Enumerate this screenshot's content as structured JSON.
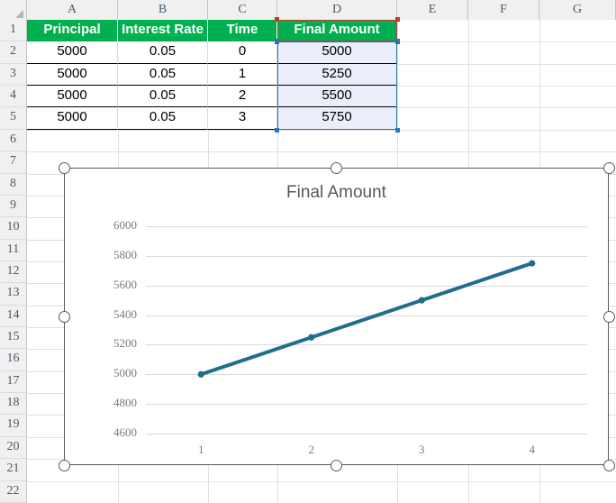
{
  "spreadsheet": {
    "column_headers": [
      "A",
      "B",
      "C",
      "D",
      "E",
      "F",
      "G"
    ],
    "row_headers": [
      "1",
      "2",
      "3",
      "4",
      "5",
      "6",
      "7",
      "8",
      "9",
      "10",
      "11",
      "12",
      "13",
      "14",
      "15",
      "16",
      "17",
      "18",
      "19",
      "20",
      "21",
      "22"
    ],
    "header_fill": "#00B050",
    "selected_fill": "#e9eef8",
    "table": {
      "headers": [
        "Principal",
        "Interest Rate",
        "Time",
        "Final Amount"
      ],
      "rows": [
        [
          "5000",
          "0.05",
          "0",
          "5000"
        ],
        [
          "5000",
          "0.05",
          "1",
          "5250"
        ],
        [
          "5000",
          "0.05",
          "2",
          "5500"
        ],
        [
          "5000",
          "0.05",
          "3",
          "5750"
        ]
      ]
    },
    "selection": {
      "series_name_range_color": "#c0392f",
      "values_range_color": "#2e75b6"
    }
  },
  "chart_data": {
    "type": "line",
    "title": "Final Amount",
    "xlabel": "",
    "ylabel": "",
    "categories": [
      "1",
      "2",
      "3",
      "4"
    ],
    "values": [
      5000,
      5250,
      5500,
      5750
    ],
    "series": [
      {
        "name": "Final Amount",
        "values": [
          5000,
          5250,
          5500,
          5750
        ]
      }
    ],
    "ylim": [
      4600,
      6000
    ],
    "ytick_labels": [
      "6000",
      "5800",
      "5600",
      "5400",
      "5200",
      "5000",
      "4800",
      "4600"
    ],
    "ytick_values": [
      6000,
      5800,
      5600,
      5400,
      5200,
      5000,
      4800,
      4600
    ],
    "xtick_labels": [
      "1",
      "2",
      "3",
      "4"
    ],
    "grid": "horizontal",
    "legend": "none",
    "line_color": "#1F6E8C",
    "marker": "circle",
    "marker_color": "#1F6E8C"
  },
  "chart_object": {
    "selected": true,
    "handle_count": 8,
    "border_color": "#5a5a5a"
  }
}
